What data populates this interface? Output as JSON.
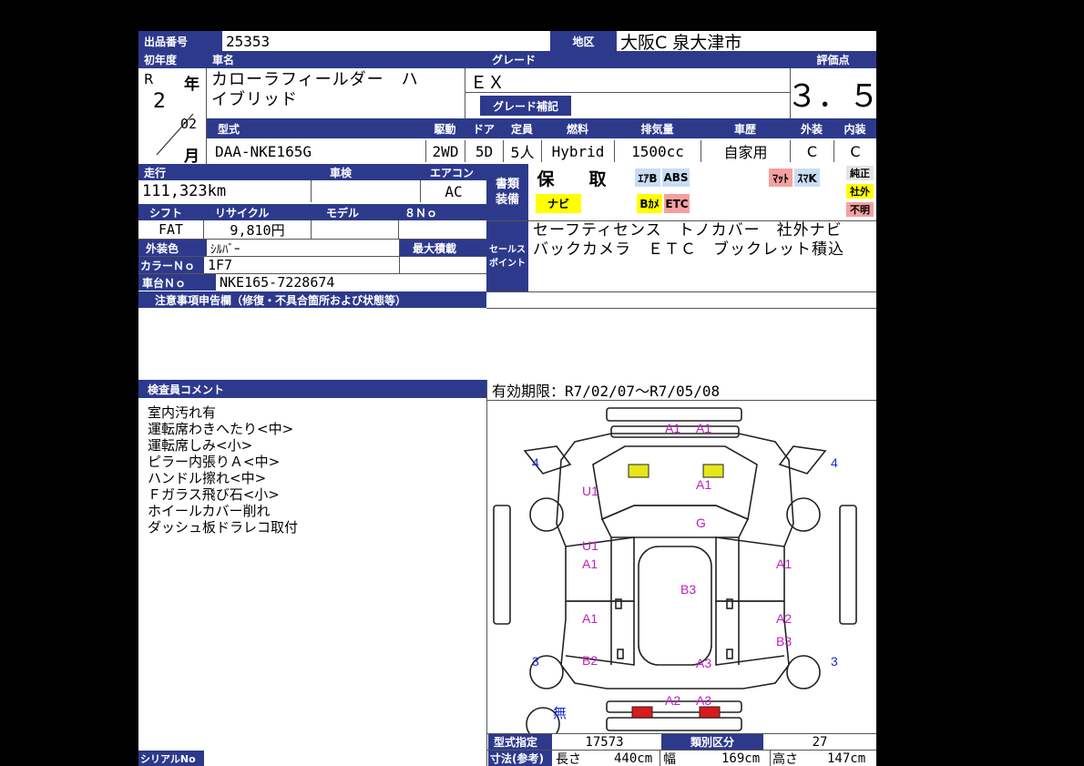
{
  "lot": {
    "label": "出品番号",
    "value": "25353",
    "area_label": "地区",
    "area_value": "大阪C 泉大津市"
  },
  "year": {
    "label": "初年度",
    "era": "R",
    "nen": "年",
    "num": "2",
    "month_num": "02",
    "tsuki": "月"
  },
  "car": {
    "name_label": "車名",
    "name_line1": "カローラフィールダー　ハ",
    "name_line2": "イブリッド",
    "model_label": "型式",
    "model_value": "DAA-NKE165G"
  },
  "grade": {
    "label": "グレード",
    "value": "ＥＸ",
    "supplement_label": "グレード補記",
    "supplement_value": ""
  },
  "score": {
    "label": "評価点",
    "value": "３．５"
  },
  "specs": {
    "labels": [
      "駆動",
      "ドア",
      "定員",
      "燃料",
      "排気量",
      "車歴",
      "外装",
      "内装"
    ],
    "values": [
      "2WD",
      "5D",
      "5人",
      "Hybrid",
      "1500cc",
      "自家用",
      "C",
      "C"
    ]
  },
  "mileage": {
    "label": "走行",
    "value": "111,323km"
  },
  "shaken": {
    "label": "車検",
    "value": ""
  },
  "aircon": {
    "label": "エアコン",
    "value": "AC"
  },
  "shift": {
    "label": "シフト",
    "value": "FAT"
  },
  "recycle": {
    "label": "リサイクル",
    "value": "9,810円"
  },
  "model_year": {
    "label": "モデル",
    "value": ""
  },
  "eight_no": {
    "label": "８Ｎｏ",
    "value": ""
  },
  "exterior_color": {
    "label": "外装色",
    "value": "ｼﾙﾊﾞｰ"
  },
  "max_load": {
    "label": "最大積載",
    "value": ""
  },
  "color_no": {
    "label": "カラーＮｏ",
    "value": "1F7"
  },
  "chassis_no": {
    "label": "車台Ｎｏ",
    "value": "NKE165-7228674"
  },
  "documents": {
    "label1": "書類",
    "label2": "装備",
    "ho": "保",
    "tori": "取",
    "navi": "ナビ"
  },
  "equipment_tags": {
    "airbag": "ｴｱB",
    "abs": "ABS",
    "back_camera": "Bｶﾒ",
    "etc": "ETC",
    "mat": "ﾏｯﾄ",
    "smart_key": "ｽﾏK",
    "junsei": "純正",
    "shagai": "社外",
    "fumei": "不明"
  },
  "sales_point": {
    "label1": "セールス",
    "label2": "ポイント",
    "text": "セーフティセンス　トノカバー　社外ナビ　バックカメラ　ＥＴＣ　ブックレット積込"
  },
  "notes": {
    "label": "注意事項申告欄（修復・不具合箇所および状態等）",
    "text": ""
  },
  "inspector": {
    "label": "検査員コメント",
    "comments": [
      "室内汚れ有",
      "運転席わきへたり<中>",
      "運転席しみ<小>",
      "ピラー内張りＡ<中>",
      "ハンドル擦れ<中>",
      "Ｆガラス飛び石<小>",
      "ホイールカバー削れ",
      "ダッシュ板ドラレコ取付"
    ]
  },
  "validity": {
    "text": "有効期限：R7/02/07〜R7/05/08"
  },
  "diagram": {
    "marks": {
      "front_bumper_a": "A1",
      "front_bumper_b": "A1",
      "bonnet": "A1",
      "windshield": "G",
      "left_fender": "U1",
      "left_front_door_u": "U1",
      "left_front_door_a": "A1",
      "roof": "B3",
      "right_front_door": "A1",
      "left_rear_door": "A1",
      "right_rear_door": "A2",
      "right_quarter": "B3",
      "left_quarter": "B2",
      "trunk": "A3",
      "rear_bumper_a": "A2",
      "rear_bumper_b": "A3"
    },
    "wheel_numbers": {
      "front_left": "4",
      "front_right": "4",
      "rear_left": "3",
      "rear_right": "3"
    },
    "spare": "無",
    "colors": {
      "yellow": "#e6e61a",
      "red": "#d81b1b",
      "mark": "#c020c0",
      "number": "#1a2ad0"
    }
  },
  "type_designation": {
    "label": "型式指定",
    "value": "17573"
  },
  "class_division": {
    "label": "類別区分",
    "value": "27"
  },
  "dimensions": {
    "label": "寸法(参考)",
    "length_label": "長さ",
    "length": "440cm",
    "width_label": "幅",
    "width": "169cm",
    "height_label": "高さ",
    "height": "147cm"
  },
  "serial": {
    "label": "シリアルNo"
  },
  "colors": {
    "header": "#2d3a8c",
    "yellow": "#ffff00",
    "pink": "#f5a0a0",
    "blue_tag": "#c8dcf5"
  }
}
